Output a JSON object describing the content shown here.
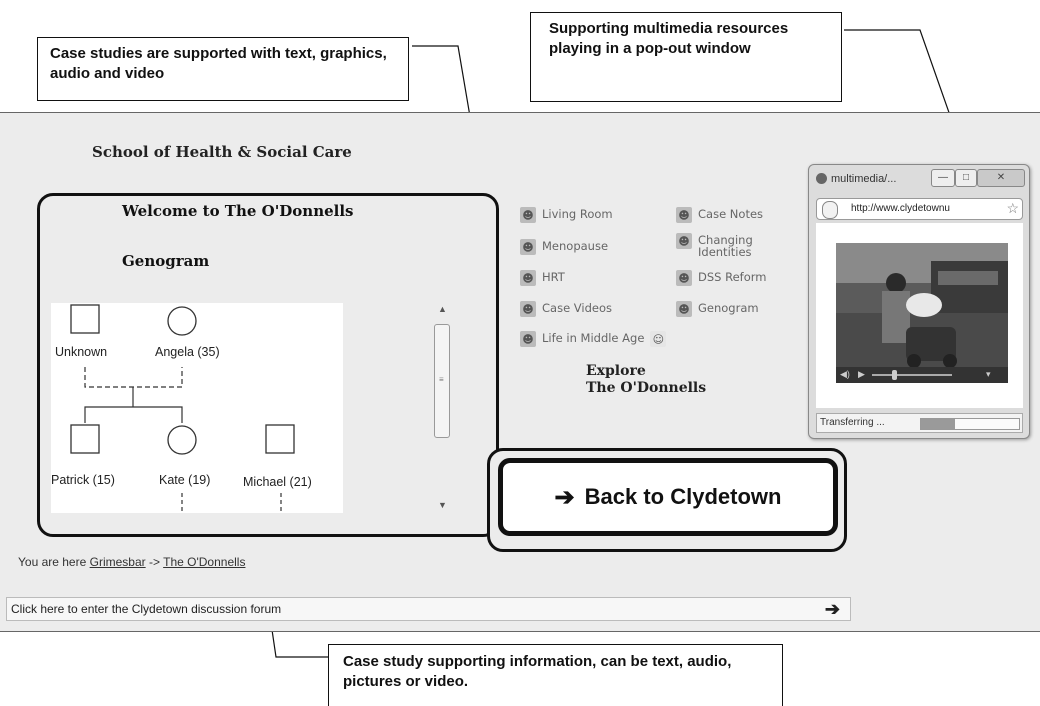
{
  "callouts": {
    "top_left": "Case studies are supported with text, graphics, audio and video",
    "top_right": "Supporting multimedia resources playing in a pop-out window",
    "bottom": "Case study supporting information, can be text, audio, pictures or video."
  },
  "app": {
    "school_title": "School of Health & Social Care",
    "welcome": "Welcome to The O'Donnells",
    "genogram_title": "Genogram",
    "genogram_people": [
      {
        "name": "Unknown"
      },
      {
        "name": "Angela (35)"
      },
      {
        "name": "Patrick (15)"
      },
      {
        "name": "Kate (19)"
      },
      {
        "name": "Michael (21)"
      }
    ],
    "links": [
      {
        "label": "Living Room"
      },
      {
        "label": "Case Notes"
      },
      {
        "label": "Menopause"
      },
      {
        "label": "Changing Identities"
      },
      {
        "label": "HRT"
      },
      {
        "label": "DSS Reform"
      },
      {
        "label": "Case Videos"
      },
      {
        "label": "Genogram"
      },
      {
        "label": "Life in Middle Age"
      }
    ],
    "explore_line1": "Explore",
    "explore_line2": "The O'Donnells",
    "back_button": "Back to Clydetown",
    "breadcrumb": {
      "prefix": "You are here",
      "link1": "Grimesbar",
      "separator": "->",
      "link2": "The O'Donnells"
    },
    "forum_link": "Click here to enter the Clydetown discussion forum"
  },
  "popup": {
    "title": "multimedia/...",
    "url": "http://www.clydetownu",
    "status": "Transferring ...",
    "progress": 0.35
  }
}
